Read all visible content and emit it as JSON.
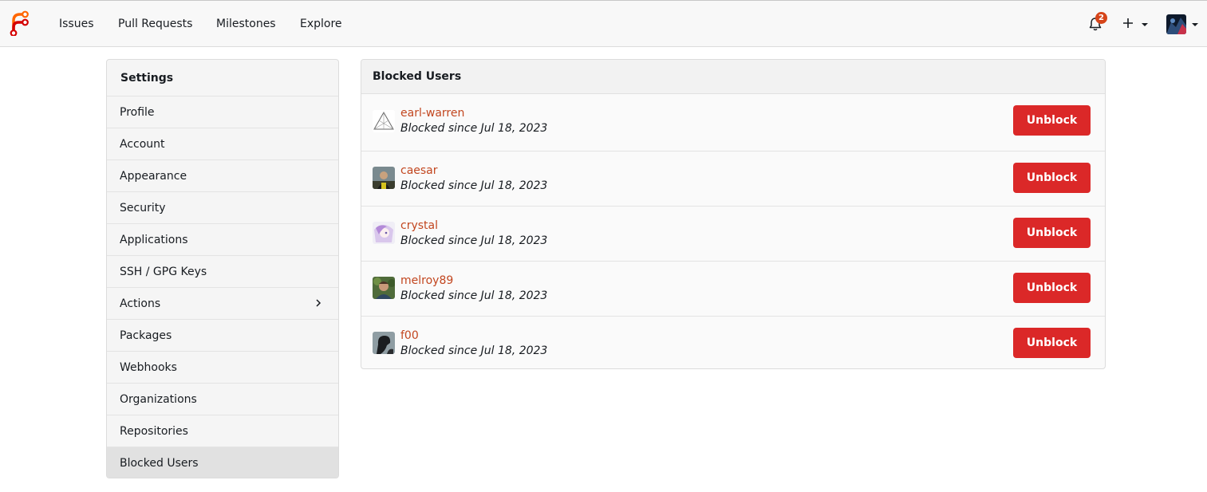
{
  "nav": {
    "items": [
      {
        "label": "Issues"
      },
      {
        "label": "Pull Requests"
      },
      {
        "label": "Milestones"
      },
      {
        "label": "Explore"
      }
    ],
    "notification_count": "2",
    "logo_icon": "forgejo-logo-icon",
    "brand_colors": {
      "orange": "#ff6600",
      "red": "#d40000"
    }
  },
  "sidebar": {
    "title": "Settings",
    "items": [
      {
        "label": "Profile"
      },
      {
        "label": "Account"
      },
      {
        "label": "Appearance"
      },
      {
        "label": "Security"
      },
      {
        "label": "Applications"
      },
      {
        "label": "SSH / GPG Keys"
      },
      {
        "label": "Actions"
      },
      {
        "label": "Packages"
      },
      {
        "label": "Webhooks"
      },
      {
        "label": "Organizations"
      },
      {
        "label": "Repositories"
      },
      {
        "label": "Blocked Users"
      }
    ],
    "active_item": "Blocked Users"
  },
  "blocked_users": {
    "title": "Blocked Users",
    "unblock_label": "Unblock",
    "accent_color": "#db2828",
    "link_color": "#c2461f",
    "users": [
      {
        "name": "earl-warren",
        "meta": "Blocked since Jul 18, 2023"
      },
      {
        "name": "caesar",
        "meta": "Blocked since Jul 18, 2023"
      },
      {
        "name": "crystal",
        "meta": "Blocked since Jul 18, 2023"
      },
      {
        "name": "melroy89",
        "meta": "Blocked since Jul 18, 2023"
      },
      {
        "name": "f00",
        "meta": "Blocked since Jul 18, 2023"
      }
    ]
  }
}
